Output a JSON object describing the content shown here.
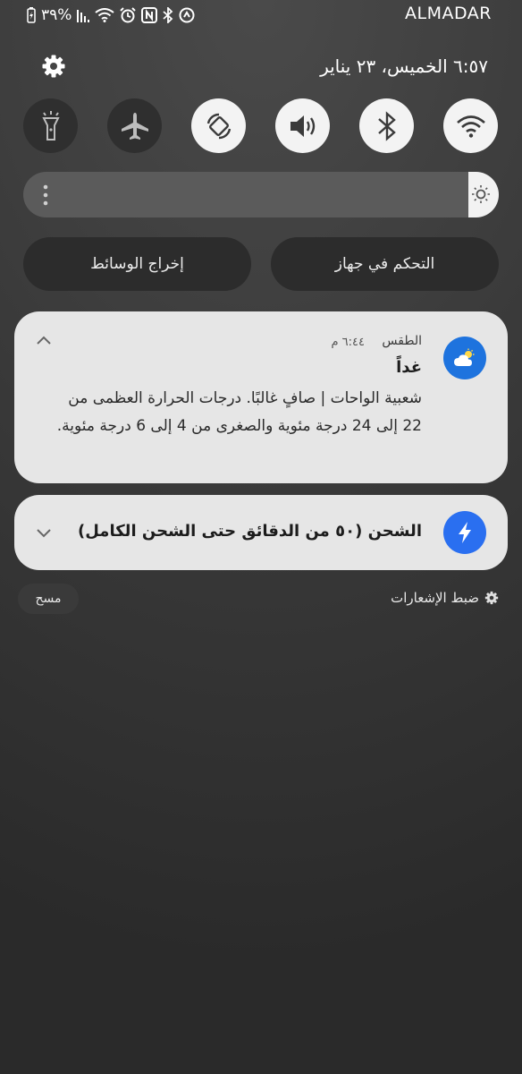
{
  "status_bar": {
    "battery_percent": "٣٩%",
    "carrier": "ALMADAR",
    "icons": [
      "battery-charging-icon",
      "signal-icon",
      "wifi-icon",
      "alarm-icon",
      "nfc-icon",
      "bluetooth-icon",
      "data-saver-icon"
    ]
  },
  "header": {
    "datetime": "٦:٥٧ الخميس، ٢٣ يناير",
    "settings_icon": "gear-icon"
  },
  "quick_tiles": [
    {
      "name": "flashlight",
      "icon": "flashlight-icon",
      "active": false
    },
    {
      "name": "airplane-mode",
      "icon": "airplane-icon",
      "active": false
    },
    {
      "name": "auto-rotate",
      "icon": "rotate-icon",
      "active": true
    },
    {
      "name": "sound",
      "icon": "speaker-icon",
      "active": true
    },
    {
      "name": "bluetooth",
      "icon": "bluetooth-icon",
      "active": true
    },
    {
      "name": "wifi",
      "icon": "wifi-icon",
      "active": true
    }
  ],
  "brightness": {
    "level": 0.06,
    "icon": "sun-icon"
  },
  "buttons": {
    "media_output": "إخراج الوسائط",
    "device_control": "التحكم في جهاز"
  },
  "notifications": [
    {
      "app": "الطقس",
      "time": "٦:٤٤ م",
      "title": "غداً",
      "body": "شعبية الواحات | صافٍ غالبًا. درجات الحرارة العظمى من 22 إلى 24 درجة مئوية والصغرى من 4 إلى 6 درجة مئوية.",
      "icon": "weather-icon",
      "accent": "#1e73de"
    },
    {
      "text": "الشحن (٥٠ من الدقائق حتى الشحن الكامل)",
      "icon": "lightning-icon",
      "accent": "#2a6ff0"
    }
  ],
  "footer": {
    "notification_settings": "ضبط الإشعارات",
    "clear": "مسح"
  },
  "colors": {
    "tile_on": "#f3f3f3",
    "tile_off": "#2f2f2f",
    "card_bg": "#e6e6e6"
  }
}
